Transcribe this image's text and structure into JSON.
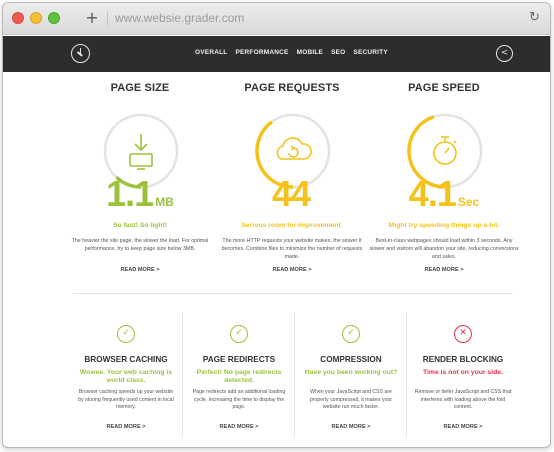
{
  "browser": {
    "url": "www.websie.grader.com",
    "new_tab_glyph": "+",
    "reload_glyph": "↻"
  },
  "navbar": {
    "links": [
      "OVERALL",
      "PERFORMANCE",
      "MOBILE",
      "SEO",
      "SECURITY"
    ],
    "logo_icon": "speedometer-icon",
    "share_icon": "share-icon"
  },
  "colors": {
    "green": "#9ac33b",
    "yellow": "#f5c21b",
    "red": "#e8334a",
    "track": "#e3e3e3",
    "nav_bg": "#2d2d2d"
  },
  "metrics": [
    {
      "title": "PAGE SIZE",
      "value": "1.1",
      "unit": "MB",
      "gauge_level": 0.12,
      "color": "#9ac33b",
      "icon": "download-icon",
      "verdict": "So fast! So light!",
      "description": "The heavier the site page, the slower the load. For optimal performance, try to keep page size below 3MB.",
      "read_more": "READ MORE >"
    },
    {
      "title": "PAGE REQUESTS",
      "value": "44",
      "unit": "",
      "gauge_level": 0.4,
      "color": "#f5c21b",
      "icon": "cloud-refresh-icon",
      "verdict": "Serious room for improvement.",
      "description": "The more HTTP requests your website makes, the slower it becomes. Combine files to minimize the number of requests made.",
      "read_more": "READ MORE >"
    },
    {
      "title": "PAGE SPEED",
      "value": "4.1",
      "unit": "Sec",
      "gauge_level": 0.45,
      "color": "#f5c21b",
      "icon": "stopwatch-icon",
      "verdict": "Might try speeding things up a bit.",
      "description": "Best-in-class webpages should load within 3 seconds. Any slower and visitors will abandon your site, reducing conversions and sales.",
      "read_more": "READ MORE >"
    }
  ],
  "cards": [
    {
      "title": "BROWSER CACHING",
      "status": "pass",
      "icon": "check-circle-icon",
      "color": "#9ac33b",
      "verdict": "Wowee. Your web caching is world class.",
      "description": "Browser caching speeds up your website by storing frequently used content in local memory.",
      "read_more": "READ MORE >"
    },
    {
      "title": "PAGE REDIRECTS",
      "status": "pass",
      "icon": "check-circle-icon",
      "color": "#9ac33b",
      "verdict": "Perfect! No page redirects detected.",
      "description": "Page redirects add an additional loading cycle, increasing the time to display the page.",
      "read_more": "READ MORE >"
    },
    {
      "title": "COMPRESSION",
      "status": "pass",
      "icon": "check-circle-icon",
      "color": "#9ac33b",
      "verdict": "Have you been working out?",
      "description": "When your JavaScript and CSS are properly compressed, it makes your website run much faster.",
      "read_more": "READ MORE >"
    },
    {
      "title": "RENDER BLOCKING",
      "status": "fail",
      "icon": "x-circle-icon",
      "color": "#e8334a",
      "verdict": "Time is not on your side.",
      "description": "Remove or defer JavaScript and CSS that interferes with loading above the fold content.",
      "read_more": "READ MORE >"
    }
  ]
}
